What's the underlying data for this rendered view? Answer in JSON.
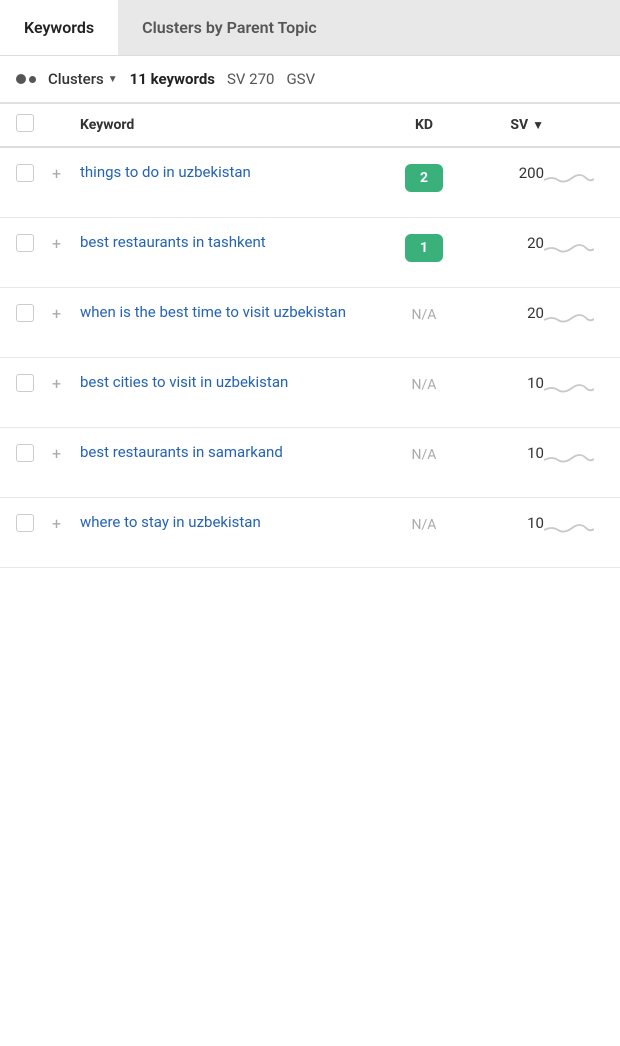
{
  "tabs": [
    {
      "label": "Keywords",
      "active": false
    },
    {
      "label": "Clusters by Parent Topic",
      "active": true
    }
  ],
  "toolbar": {
    "cluster_icon": "clusters-icon",
    "clusters_label": "Clusters",
    "keywords_count": "11 keywords",
    "sv_label": "SV 270",
    "gsv_label": "GSV"
  },
  "table": {
    "columns": {
      "keyword": "Keyword",
      "kd": "KD",
      "sv": "SV"
    },
    "rows": [
      {
        "keyword": "things to do in uzbekistan",
        "kd": "2",
        "kd_type": "badge_green",
        "sv": "200"
      },
      {
        "keyword": "best restaurants in tashkent",
        "kd": "1",
        "kd_type": "badge_green",
        "sv": "20"
      },
      {
        "keyword": "when is the best time to visit uzbekistan",
        "kd": "N/A",
        "kd_type": "na",
        "sv": "20"
      },
      {
        "keyword": "best cities to visit in uzbekistan",
        "kd": "N/A",
        "kd_type": "na",
        "sv": "10"
      },
      {
        "keyword": "best restaurants in samarkand",
        "kd": "N/A",
        "kd_type": "na",
        "sv": "10"
      },
      {
        "keyword": "where to stay in uzbekistan",
        "kd": "N/A",
        "kd_type": "na",
        "sv": "10"
      }
    ]
  }
}
